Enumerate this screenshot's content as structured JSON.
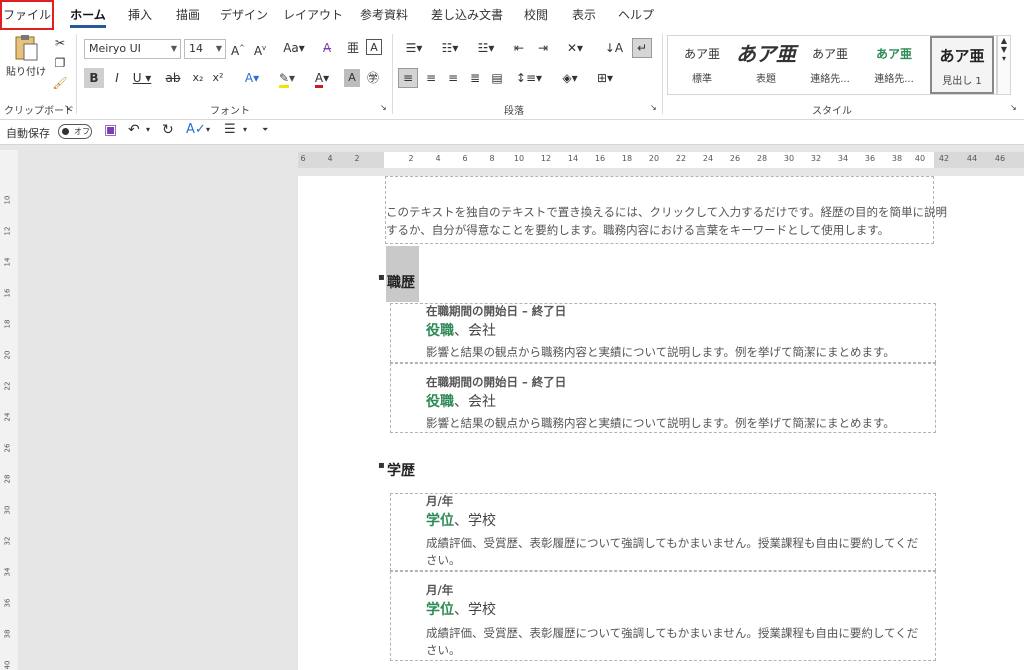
{
  "tabs": [
    "ファイル",
    "ホーム",
    "挿入",
    "描画",
    "デザイン",
    "レイアウト",
    "参考資料",
    "差し込み文書",
    "校閲",
    "表示",
    "ヘルプ"
  ],
  "ribbon": {
    "clipboard": {
      "paste": "貼り付け",
      "label": "クリップボード"
    },
    "font": {
      "name": "Meiryo UI",
      "size": "14",
      "label": "フォント"
    },
    "paragraph": {
      "label": "段落"
    },
    "styles": {
      "label": "スタイル",
      "items": [
        {
          "preview": "あア亜",
          "name": "標準"
        },
        {
          "preview": "あア亜",
          "name": "表題"
        },
        {
          "preview": "あア亜",
          "name": "連絡先..."
        },
        {
          "preview": "あア亜",
          "name": "連絡先..."
        },
        {
          "preview": "あア亜",
          "name": "見出し 1"
        }
      ]
    }
  },
  "qat": {
    "autosave": "自動保存",
    "toggle": "オフ"
  },
  "ruler": [
    "6",
    "4",
    "2",
    "2",
    "4",
    "6",
    "8",
    "10",
    "12",
    "14",
    "16",
    "18",
    "20",
    "22",
    "24",
    "26",
    "28",
    "30",
    "32",
    "34",
    "36",
    "38",
    "40",
    "42",
    "44",
    "46"
  ],
  "vruler": [
    "10",
    "12",
    "14",
    "16",
    "18",
    "20",
    "22",
    "24",
    "26",
    "28",
    "30",
    "32",
    "34",
    "36",
    "38",
    "40"
  ],
  "document": {
    "intro": [
      "このテキストを独自のテキストで置き換えるには、クリックして入力するだけです。経歴の目的を簡単に説明",
      "するか、自分が得意なことを要約します。職務内容における言葉をキーワードとして使用します。"
    ],
    "experience_heading": "職歴",
    "jobs": [
      {
        "dates": "在職期間の開始日 – 終了日",
        "title": "役職",
        "company": "、会社",
        "desc": "影響と結果の観点から職務内容と実績について説明します。例を挙げて簡潔にまとめます。"
      },
      {
        "dates": "在職期間の開始日 – 終了日",
        "title": "役職",
        "company": "、会社",
        "desc": "影響と結果の観点から職務内容と実績について説明します。例を挙げて簡潔にまとめます。"
      }
    ],
    "education_heading": "学歴",
    "schools": [
      {
        "date": "月/年",
        "degree": "学位",
        "school": "、学校",
        "desc1": "成績評価、受賞歴、表彰履歴について強調してもかまいません。授業課程も自由に要約してくだ",
        "desc2": "さい。"
      },
      {
        "date": "月/年",
        "degree": "学位",
        "school": "、学校",
        "desc1": "成績評価、受賞歴、表彰履歴について強調してもかまいません。授業課程も自由に要約してくだ",
        "desc2": "さい。"
      }
    ]
  }
}
